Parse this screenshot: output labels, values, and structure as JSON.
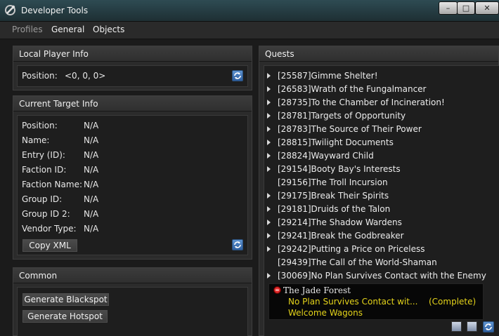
{
  "window": {
    "title": "Developer Tools",
    "min_glyph": "–",
    "max_glyph": "□",
    "close_glyph": "✕"
  },
  "menu": {
    "items": [
      "Profiles",
      "General",
      "Objects"
    ]
  },
  "local_player": {
    "header": "Local Player Info",
    "position_label": "Position:",
    "position_value": "<0, 0, 0>",
    "refresh_icon": "refresh-icon"
  },
  "current_target": {
    "header": "Current Target Info",
    "fields": [
      {
        "label": "Position:",
        "value": "N/A"
      },
      {
        "label": "Name:",
        "value": "N/A"
      },
      {
        "label": "Entry (ID):",
        "value": "N/A"
      },
      {
        "label": "Faction ID:",
        "value": "N/A"
      },
      {
        "label": "Faction Name:",
        "value": "N/A"
      },
      {
        "label": "Group ID:",
        "value": "N/A"
      },
      {
        "label": "Group ID 2:",
        "value": "N/A"
      },
      {
        "label": "Vendor Type:",
        "value": "N/A"
      }
    ],
    "copy_xml_label": "Copy XML",
    "refresh_icon": "refresh-icon"
  },
  "common": {
    "header": "Common",
    "generate_blackspot_label": "Generate Blackspot",
    "generate_hotspot_label": "Generate Hotspot"
  },
  "quests": {
    "header": "Quests",
    "items": [
      {
        "text": "[25587]Gimme Shelter!",
        "expandable": true
      },
      {
        "text": "[26583]Wrath of the Fungalmancer",
        "expandable": true
      },
      {
        "text": "[28735]To the Chamber of Incineration!",
        "expandable": true
      },
      {
        "text": "[28781]Targets of Opportunity",
        "expandable": true
      },
      {
        "text": "[28783]The Source of Their Power",
        "expandable": true
      },
      {
        "text": "[28815]Twilight Documents",
        "expandable": true
      },
      {
        "text": "[28824]Wayward Child",
        "expandable": true
      },
      {
        "text": "[29154]Booty Bay's Interests",
        "expandable": true
      },
      {
        "text": "[29156]The Troll Incursion",
        "expandable": false
      },
      {
        "text": "[29175]Break Their Spirits",
        "expandable": true
      },
      {
        "text": "[29181]Druids of the Talon",
        "expandable": true
      },
      {
        "text": "[29214]The Shadow Wardens",
        "expandable": true
      },
      {
        "text": "[29241]Break the Godbreaker",
        "expandable": true
      },
      {
        "text": "[29242]Putting a Price on Priceless",
        "expandable": true
      },
      {
        "text": "[29439]The Call of the World-Shaman",
        "expandable": false
      },
      {
        "text": "[30069]No Plan Survives Contact with the Enemy",
        "expandable": true
      }
    ],
    "tracker": {
      "zone": "The Jade Forest",
      "quest": "No Plan Survives Contact wit...",
      "status": "(Complete)",
      "quest2": "Welcome Wagons"
    }
  },
  "colors": {
    "tracker_text": "#e4d31a",
    "refresh_blue": "#3f73b5",
    "collapse_red": "#d01010"
  }
}
